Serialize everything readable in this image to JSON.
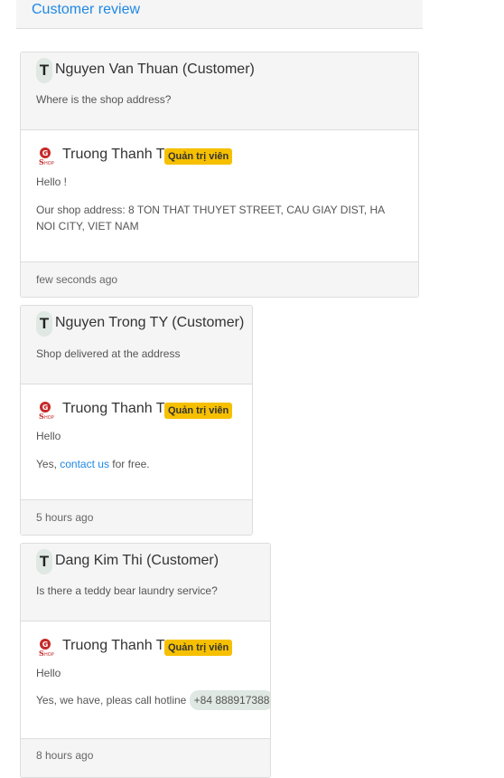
{
  "header": {
    "title": "Customer review"
  },
  "reviews": [
    {
      "initial": "T",
      "customer_name": "Nguyen Van Thuan (Customer)",
      "question": "Where is the shop address?",
      "reply": {
        "author": "Truong Thanh Tu",
        "badge": "Quản trị viên",
        "line1": "Hello !",
        "line2": "Our shop address: 8 TON THAT THUYET STREET, CAU GIAY DIST, HA NOI CITY, VIET NAM"
      },
      "time": "few seconds ago"
    },
    {
      "initial": "T",
      "customer_name": "Nguyen Trong TY (Customer)",
      "question": "Shop delivered at the address",
      "reply": {
        "author": "Truong Thanh Tu",
        "badge": "Quản trị viên",
        "line1": "Hello",
        "line2_pre": "Yes, ",
        "line2_link": "contact us",
        "line2_post": " for free."
      },
      "time": "5 hours ago"
    },
    {
      "initial": "T",
      "customer_name": "Dang Kim Thi (Customer)",
      "question": "Is there a teddy bear laundry service?",
      "reply": {
        "author": "Truong Thanh Tu",
        "badge": "Quản trị viên",
        "line1": "Hello",
        "line2_pre": "Yes, we have, pleas call hotline ",
        "line2_phone": "+84 888917388",
        "line2_post": "."
      },
      "time": "8 hours ago"
    }
  ],
  "icons": {
    "customer_avatar": "letter-avatar-icon",
    "shop_logo": "shop-logo-icon"
  },
  "colors": {
    "accent": "#1e88e5",
    "badge": "#f6c000"
  }
}
